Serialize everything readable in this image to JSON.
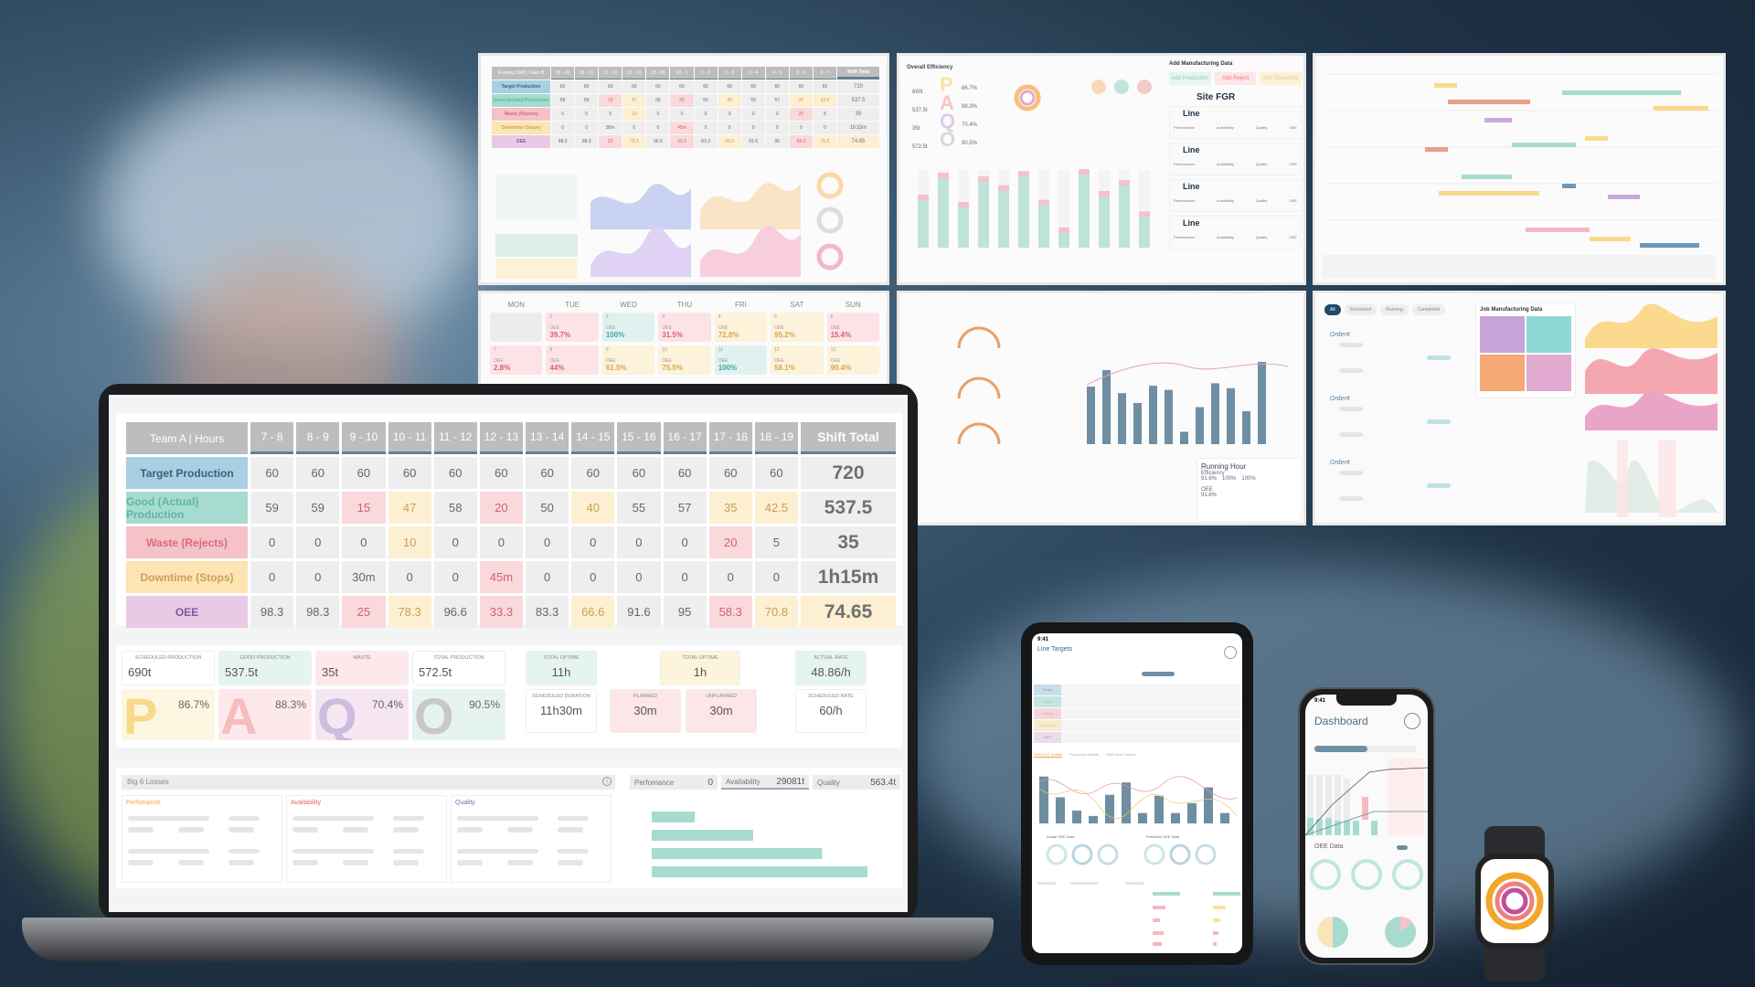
{
  "colors": {
    "green": "#a8dbd0",
    "red": "#f4c2c7",
    "yellow": "#fce4b3",
    "purple": "#e9c9e6",
    "blue": "#a9cfe3",
    "bar": "#6f8ea3",
    "orange": "#f4a62a",
    "magenta": "#c0509a",
    "coral": "#f07e7e"
  },
  "laptop": {
    "table": {
      "corner": "Team A | Hours",
      "hours": [
        "7 - 8",
        "8 - 9",
        "9 - 10",
        "10 - 11",
        "11 - 12",
        "12 - 13",
        "13 - 14",
        "14 - 15",
        "15 - 16",
        "16 - 17",
        "17 - 18",
        "18 - 19"
      ],
      "total_header": "Shift Total",
      "rows": [
        {
          "label": "Target Production",
          "tone": "blue",
          "values": [
            "60",
            "60",
            "60",
            "60",
            "60",
            "60",
            "60",
            "60",
            "60",
            "60",
            "60",
            "60"
          ],
          "status": [
            "",
            "",
            "",
            "",
            "",
            "",
            "",
            "",
            "",
            "",
            "",
            ""
          ],
          "total": "720",
          "total_status": ""
        },
        {
          "label": "Good (Actual) Production",
          "tone": "green",
          "values": [
            "59",
            "59",
            "15",
            "47",
            "58",
            "20",
            "50",
            "40",
            "55",
            "57",
            "35",
            "42.5"
          ],
          "status": [
            "",
            "",
            "r",
            "y",
            "",
            "r",
            "",
            "y",
            "",
            "",
            "y",
            "y"
          ],
          "total": "537.5",
          "total_status": ""
        },
        {
          "label": "Waste (Rejects)",
          "tone": "red",
          "values": [
            "0",
            "0",
            "0",
            "10",
            "0",
            "0",
            "0",
            "0",
            "0",
            "0",
            "20",
            "5"
          ],
          "status": [
            "",
            "",
            "",
            "y",
            "",
            "",
            "",
            "",
            "",
            "",
            "r",
            ""
          ],
          "total": "35",
          "total_status": ""
        },
        {
          "label": "Downtime (Stops)",
          "tone": "yellow",
          "values": [
            "0",
            "0",
            "30m",
            "0",
            "0",
            "45m",
            "0",
            "0",
            "0",
            "0",
            "0",
            "0"
          ],
          "status": [
            "",
            "",
            "",
            "",
            "",
            "r",
            "",
            "",
            "",
            "",
            "",
            ""
          ],
          "total": "1h15m",
          "total_status": ""
        },
        {
          "label": "OEE",
          "tone": "purple",
          "values": [
            "98.3",
            "98.3",
            "25",
            "78.3",
            "96.6",
            "33.3",
            "83.3",
            "66.6",
            "91.6",
            "95",
            "58.3",
            "70.8"
          ],
          "status": [
            "",
            "",
            "r",
            "y",
            "",
            "r",
            "",
            "y",
            "",
            "",
            "r",
            "y"
          ],
          "total": "74.65",
          "total_status": "y"
        }
      ]
    },
    "kpis": [
      {
        "label": "Scheduled Production",
        "value": "690t"
      },
      {
        "label": "Good Production",
        "value": "537.5t"
      },
      {
        "label": "Waste",
        "value": "35t"
      },
      {
        "label": "Total Production",
        "value": "572.5t"
      }
    ],
    "pqao": [
      {
        "letter": "P",
        "value": "86.7%"
      },
      {
        "letter": "A",
        "value": "88.3%"
      },
      {
        "letter": "Q",
        "value": "70.4%"
      },
      {
        "letter": "O",
        "value": "90.5%"
      }
    ],
    "uptime": [
      {
        "label": "Total Uptime",
        "value": "11h"
      },
      {
        "label": "Total Uptime",
        "value": "1h"
      },
      {
        "label": "Actual Rate",
        "value": "48.86/h"
      },
      {
        "label": "Scheduled Duration",
        "value": "11h30m"
      },
      {
        "label": "Planned",
        "value": "30m"
      },
      {
        "label": "Unplanned",
        "value": "30m"
      },
      {
        "label": "Scheduled Rate",
        "value": "60/h"
      }
    ],
    "losses": {
      "title": "Big 6 Losses",
      "columns": [
        "Perfomance",
        "Availability",
        "Quality"
      ]
    },
    "loss_tabs": [
      {
        "label": "Perfomance",
        "value": "0"
      },
      {
        "label": "Availability",
        "value": "29081t"
      },
      {
        "label": "Quality",
        "value": "563.4t"
      }
    ],
    "loss_bars": [
      0.2,
      0.47,
      0.79,
      1.0
    ]
  },
  "wall": {
    "mini_table": {
      "corner": "Evening Shift | Team B",
      "hours": [
        "19 - 20",
        "20 - 21",
        "21 - 22",
        "22 - 23",
        "23 - 00",
        "00 - 1",
        "1 - 2",
        "2 - 3",
        "3 - 4",
        "4 - 5",
        "5 - 6",
        "6 - 7"
      ],
      "total_header": "Shift Total"
    },
    "calendar": {
      "days": [
        "MON",
        "TUE",
        "WED",
        "THU",
        "FRI",
        "SAT",
        "SUN"
      ],
      "label": "OEE",
      "cells": [
        null,
        {
          "day": "1",
          "value": "39.7%",
          "tone": "red"
        },
        {
          "day": "2",
          "value": "100%",
          "tone": "green"
        },
        {
          "day": "3",
          "value": "31.5%",
          "tone": "red"
        },
        {
          "day": "4",
          "value": "72.8%",
          "tone": "yellow"
        },
        {
          "day": "5",
          "value": "95.2%",
          "tone": "yellow"
        },
        {
          "day": "6",
          "value": "15.4%",
          "tone": "red"
        },
        {
          "day": "7",
          "value": "2.8%",
          "tone": "red"
        },
        {
          "day": "8",
          "value": "44%",
          "tone": "red"
        },
        {
          "day": "9",
          "value": "61.5%",
          "tone": "yellow"
        },
        {
          "day": "10",
          "value": "75.5%",
          "tone": "yellow"
        },
        {
          "day": "11",
          "value": "100%",
          "tone": "green"
        },
        {
          "day": "12",
          "value": "58.1%",
          "tone": "yellow"
        },
        {
          "day": "13",
          "value": "90.4%",
          "tone": "yellow"
        }
      ]
    },
    "efficiency": {
      "title": "Overall Efficiency",
      "values": [
        "690t",
        "537.5t",
        "35t",
        "572.5t"
      ],
      "pcts": [
        "86.7%",
        "88.3%",
        "70.4%",
        "90.5%"
      ]
    },
    "manufacturing": {
      "title": "Add Manufacturing Data",
      "buttons": [
        "Add Production",
        "Add Reject",
        "Add Downtime"
      ],
      "site": "Site FGR",
      "line": "Line",
      "metrics": [
        "Performance",
        "Availability",
        "Quality",
        "OEE"
      ]
    },
    "running": {
      "title": "Running Hour",
      "efficiency": "Efficiency",
      "items": [
        {
          "label": "Performance",
          "value": "91.6%"
        },
        {
          "label": "Availability",
          "value": "100%"
        },
        {
          "label": "Quality",
          "value": "100%"
        }
      ],
      "oee_label": "OEE",
      "oee": "91.6%"
    },
    "orders": {
      "tabs": [
        "All",
        "Scheduled",
        "Running",
        "Completed"
      ],
      "order_label": "Order#",
      "job_title": "Job Manufacturing Data"
    }
  },
  "tablet": {
    "time": "9:41",
    "title": "Line Targets",
    "tabs": [
      "Shift OEE Details",
      "Production Details",
      "Shift Work Orders"
    ],
    "rows": [
      "Target",
      "Actual",
      "Rejects",
      "Downtime",
      "OEE"
    ],
    "circle_titles": [
      "Actual OEE Data",
      "Predicted OEE Data"
    ],
    "bars": [
      0.95,
      0.53,
      0.26,
      0.15,
      0.58,
      0.83,
      0.21,
      0.56,
      0.21,
      0.41,
      0.73,
      0.21
    ]
  },
  "phone": {
    "time": "9:41",
    "title": "Dashboard",
    "section": "OEE Data"
  }
}
